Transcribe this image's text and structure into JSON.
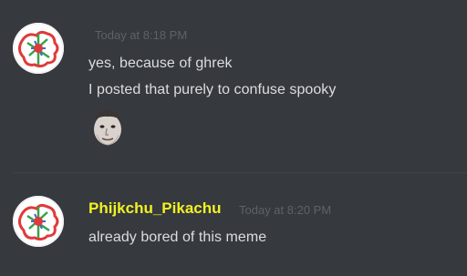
{
  "messages": [
    {
      "username": "",
      "timestamp": "Today at 8:18 PM",
      "lines": [
        "yes, because of ghrek",
        "I posted that purely to confuse spooky"
      ],
      "emoji": "custom-emoji-face-icon"
    },
    {
      "username": "Phijkchu_Pikachu",
      "timestamp": "Today at 8:20 PM",
      "lines": [
        "already bored of this meme"
      ]
    }
  ],
  "colors": {
    "background": "#36393e",
    "username": "#f1f123",
    "message_text": "#dcddde",
    "timestamp": "#5f6166"
  }
}
